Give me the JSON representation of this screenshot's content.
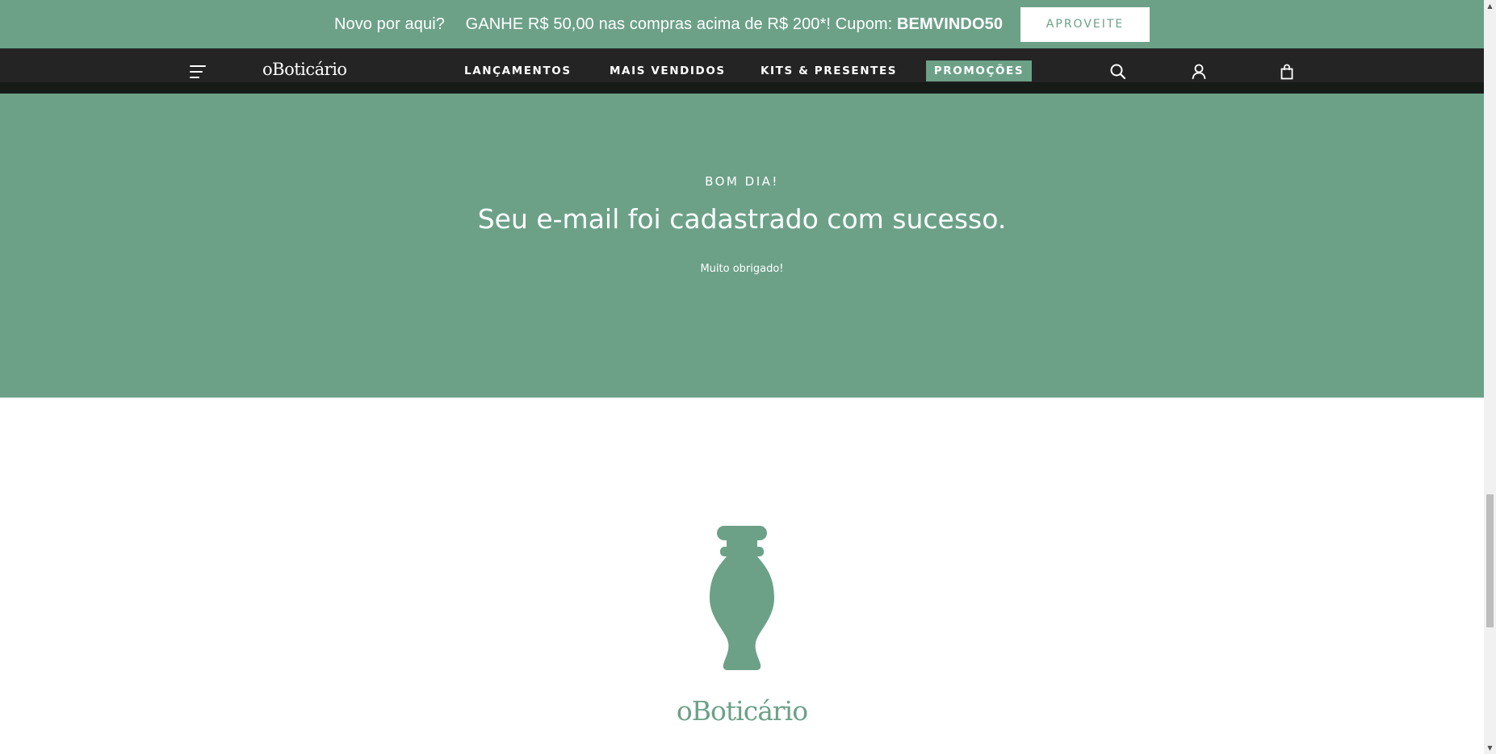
{
  "promo_bar": {
    "greeting": "Novo por aqui?",
    "offer_text": "GANHE R$ 50,00 nas compras acima de R$ 200*! Cupom:",
    "coupon_code": "BEMVINDO50",
    "cta_label": "APROVEITE"
  },
  "nav": {
    "logo": "oBoticário",
    "links": [
      "LANÇAMENTOS",
      "MAIS VENDIDOS",
      "KITS & PRESENTES"
    ],
    "promo_label": "PROMOÇÕES",
    "icons": [
      "menu-icon",
      "search-icon",
      "user-icon",
      "shopping-bag-icon"
    ]
  },
  "hero": {
    "eyebrow": "BOM DIA!",
    "title": "Seu e-mail foi cadastrado com sucesso.",
    "subtitle": "Muito obrigado!"
  },
  "footer_brand": {
    "logo": "oBoticário",
    "icon": "perfume-bottle-icon"
  },
  "colors": {
    "brand_green": "#6ca188",
    "nav_dark": "#242424",
    "white": "#ffffff"
  }
}
